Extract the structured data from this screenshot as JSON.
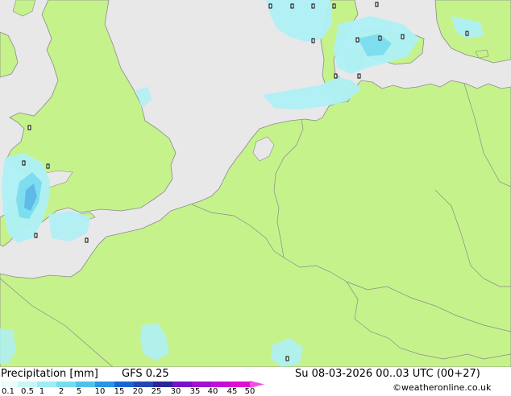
{
  "map": {
    "colors": {
      "sea": "#e8e8e8",
      "land": "#c6f28c",
      "border": "#8a8a8a",
      "coast": "#8a8a8a",
      "precip_light": "#aef0f5",
      "precip_medium": "#78dcee",
      "precip_heavy": "#5ab4e6"
    }
  },
  "footer": {
    "title": "Precipitation [mm]",
    "model": "GFS 0.25",
    "valid_time": "Su 08-03-2026 00..03 UTC (00+27)",
    "credit": "©weatheronline.co.uk",
    "scale_ticks": [
      "0.1",
      "0.5",
      "1",
      "2",
      "5",
      "10",
      "15",
      "20",
      "25",
      "30",
      "35",
      "40",
      "45",
      "50"
    ],
    "scale_colors": [
      "#eafcfc",
      "#c8f6f6",
      "#a0ecf4",
      "#78dcee",
      "#50c2ea",
      "#2896e2",
      "#1c64d2",
      "#2446b4",
      "#2a2696",
      "#7a10c8",
      "#a012d2",
      "#c40ed8",
      "#e00cd0",
      "#f050e0"
    ]
  }
}
